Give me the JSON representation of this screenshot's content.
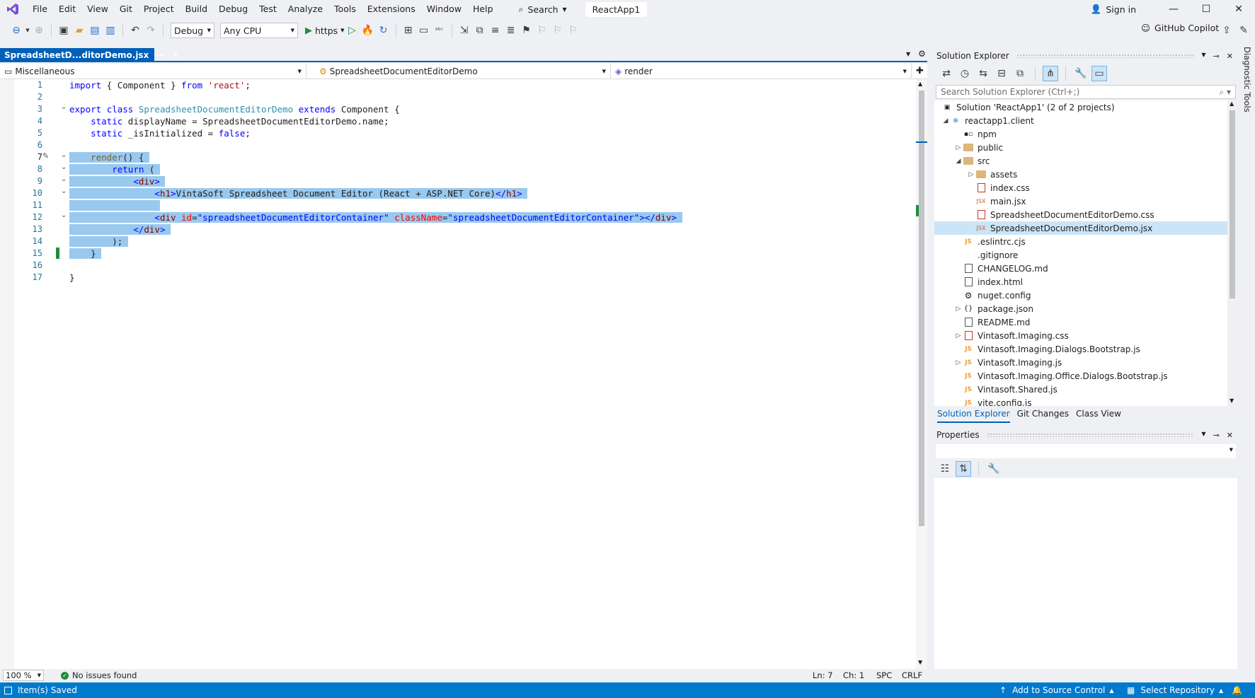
{
  "app": {
    "title_pill": "ReactApp1",
    "search_label": "Search",
    "sign_in": "Sign in",
    "copilot": "GitHub Copilot"
  },
  "menu": [
    "File",
    "Edit",
    "View",
    "Git",
    "Project",
    "Build",
    "Debug",
    "Test",
    "Analyze",
    "Tools",
    "Extensions",
    "Window",
    "Help"
  ],
  "toolbar": {
    "config": "Debug",
    "platform": "Any CPU",
    "run_target": "https"
  },
  "editor": {
    "tab_label": "SpreadsheetD...ditorDemo.jsx",
    "nav_project": "Miscellaneous",
    "nav_class": "SpreadsheetDocumentEditorDemo",
    "nav_member": "render",
    "zoom": "100 %",
    "issues": "No issues found",
    "line": "Ln: 7",
    "col": "Ch: 1",
    "spacing": "SPC",
    "eol": "CRLF",
    "line_numbers": [
      "1",
      "2",
      "3",
      "4",
      "5",
      "6",
      "7",
      "8",
      "9",
      "10",
      "11",
      "12",
      "13",
      "14",
      "15",
      "16",
      "17"
    ]
  },
  "solution_explorer": {
    "title": "Solution Explorer",
    "search_placeholder": "Search Solution Explorer (Ctrl+;)",
    "items": [
      {
        "label": "Solution 'ReactApp1' (2 of 2 projects)"
      },
      {
        "label": "reactapp1.client"
      },
      {
        "label": "npm"
      },
      {
        "label": "public"
      },
      {
        "label": "src"
      },
      {
        "label": "assets"
      },
      {
        "label": "index.css"
      },
      {
        "label": "main.jsx"
      },
      {
        "label": "SpreadsheetDocumentEditorDemo.css"
      },
      {
        "label": "SpreadsheetDocumentEditorDemo.jsx"
      },
      {
        "label": ".eslintrc.cjs"
      },
      {
        "label": ".gitignore"
      },
      {
        "label": "CHANGELOG.md"
      },
      {
        "label": "index.html"
      },
      {
        "label": "nuget.config"
      },
      {
        "label": "package.json"
      },
      {
        "label": "README.md"
      },
      {
        "label": "Vintasoft.Imaging.css"
      },
      {
        "label": "Vintasoft.Imaging.Dialogs.Bootstrap.js"
      },
      {
        "label": "Vintasoft.Imaging.js"
      },
      {
        "label": "Vintasoft.Imaging.Office.Dialogs.Bootstrap.js"
      },
      {
        "label": "Vintasoft.Shared.js"
      },
      {
        "label": "vite.config.js"
      }
    ],
    "tabs": [
      "Solution Explorer",
      "Git Changes",
      "Class View"
    ]
  },
  "properties": {
    "title": "Properties"
  },
  "diagnostic_tools": "Diagnostic Tools",
  "statusbar": {
    "message": "Item(s) Saved",
    "source_control": "Add to Source Control",
    "repository": "Select Repository"
  }
}
